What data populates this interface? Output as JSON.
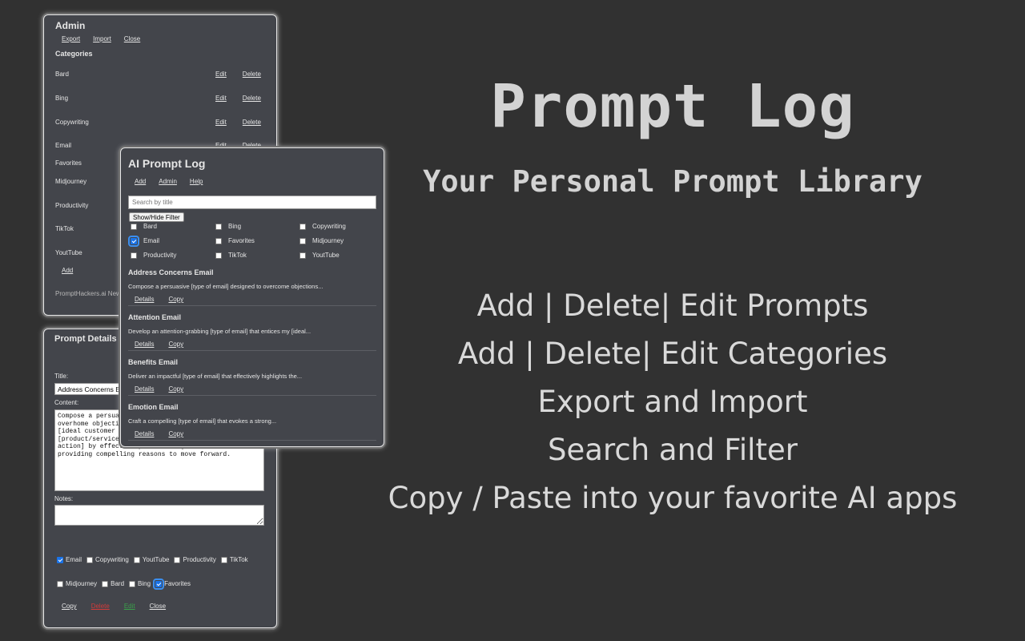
{
  "admin": {
    "title": "Admin",
    "links": [
      "Export",
      "Import",
      "Close"
    ],
    "categories_heading": "Categories",
    "categories": [
      "Bard",
      "Bing",
      "Copywriting",
      "Email",
      "Favorites",
      "Midjourney",
      "Productivity",
      "TikTok",
      "YoutTube"
    ],
    "edit_label": "Edit",
    "delete_label": "Delete",
    "add_label": "Add",
    "footer": "PromptHackers.ai Newsle"
  },
  "details": {
    "title": "Prompt Details",
    "title_label": "Title:",
    "title_value": "Address Concerns Em",
    "content_label": "Content:",
    "content_value": "Compose a persuasi\noverhome objectio\n[ideal customer p\n[product/service\naction] by effectively addressing their doubts and\nproviding compelling reasons to move forward.",
    "notes_label": "Notes:",
    "checkbox_row1": [
      {
        "label": "Email",
        "checked": true
      },
      {
        "label": "Copywriting",
        "checked": false
      },
      {
        "label": "YoutTube",
        "checked": false
      },
      {
        "label": "Productivity",
        "checked": false
      },
      {
        "label": "TikTok",
        "checked": false
      }
    ],
    "checkbox_row2": [
      {
        "label": "Midjourney",
        "checked": false
      },
      {
        "label": "Bard",
        "checked": false
      },
      {
        "label": "Bing",
        "checked": false
      },
      {
        "label": "Favorites",
        "checked": true
      }
    ],
    "buttons": {
      "copy": "Copy",
      "delete": "Delete",
      "save": "Edit",
      "close": "Close"
    }
  },
  "main": {
    "title": "AI Prompt Log",
    "links": [
      "Add",
      "Admin",
      "Help"
    ],
    "search_placeholder": "Search by title",
    "filter_button": "Show/Hide Filter",
    "filters": [
      {
        "label": "Bard",
        "checked": false
      },
      {
        "label": "Bing",
        "checked": false
      },
      {
        "label": "Copywriting",
        "checked": false
      },
      {
        "label": "Email",
        "checked": true
      },
      {
        "label": "Favorites",
        "checked": false
      },
      {
        "label": "Midjourney",
        "checked": false
      },
      {
        "label": "Productivity",
        "checked": false
      },
      {
        "label": "TikTok",
        "checked": false
      },
      {
        "label": "YoutTube",
        "checked": false
      }
    ],
    "prompts": [
      {
        "title": "Address Concerns Email",
        "desc": "Compose a persuasive [type of email] designed to overcome objections..."
      },
      {
        "title": "Attention Email",
        "desc": "Develop an attention-grabbing [type of email] that entices my [ideal..."
      },
      {
        "title": "Benefits Email",
        "desc": "Deliver an impactful [type of email] that effectively highlights the..."
      },
      {
        "title": "Emotion Email",
        "desc": "Craft a compelling [type of email] that evokes a strong..."
      }
    ],
    "details_label": "Details",
    "copy_label": "Copy"
  },
  "hero": {
    "title": "Prompt Log",
    "subtitle": "Your Personal Prompt Library",
    "features": [
      "Add | Delete| Edit Prompts",
      "Add | Delete| Edit Categories",
      "Export and Import",
      "Search and Filter",
      "Copy / Paste into your favorite AI apps"
    ]
  }
}
